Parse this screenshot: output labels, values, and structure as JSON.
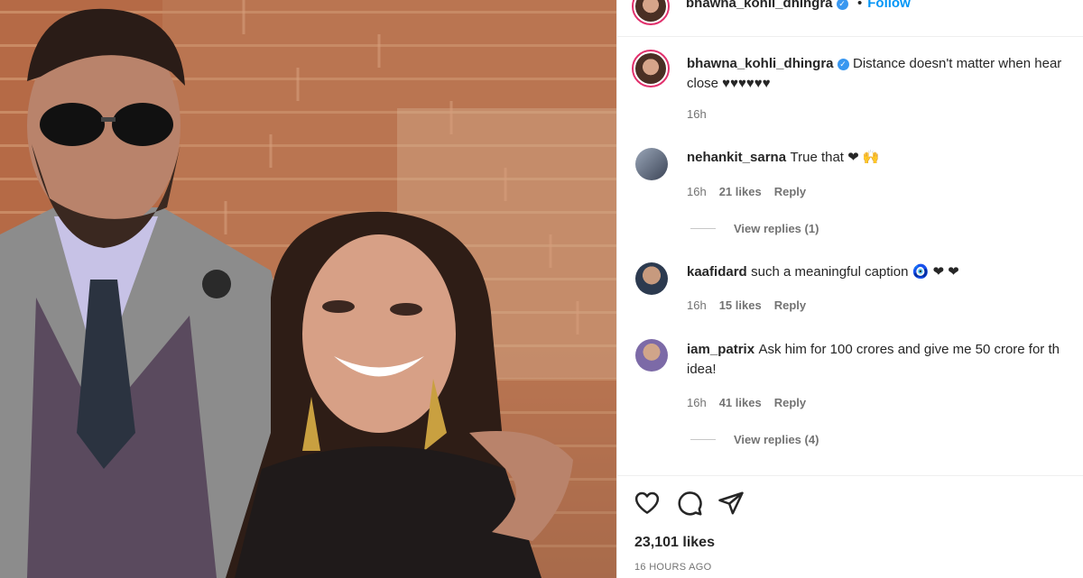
{
  "post": {
    "author": "bhawna_kohli_dhingra",
    "follow_label": "Follow",
    "follow_dot": "•",
    "caption_text": "Distance doesn't matter when hear",
    "caption_text_cont": "close ♥♥♥♥♥♥",
    "caption_time": "16h",
    "likes_label": "23,101 likes",
    "posted_ago": "16 HOURS AGO"
  },
  "comments": [
    {
      "user": "nehankit_sarna",
      "text": "True that ❤ 🙌",
      "time": "16h",
      "likes": "21 likes",
      "reply": "Reply",
      "view_replies": "View replies (1)"
    },
    {
      "user": "kaafidard",
      "text": "such a meaningful caption 🧿 ❤ ❤",
      "time": "16h",
      "likes": "15 likes",
      "reply": "Reply"
    },
    {
      "user": "iam_patrix",
      "text": "Ask him for 100 crores and give me 50 crore for th",
      "text_cont": "idea!",
      "time": "16h",
      "likes": "41 likes",
      "reply": "Reply",
      "view_replies": "View replies (4)"
    }
  ],
  "icons": {
    "like": "heart-icon",
    "comment": "comment-icon",
    "share": "paper-plane-icon",
    "verified": "verified-badge-icon"
  },
  "colors": {
    "accent_blue": "#0095f6",
    "verified_blue": "#3897f0",
    "muted_text": "#737373",
    "story_ring": "#e1306c"
  }
}
